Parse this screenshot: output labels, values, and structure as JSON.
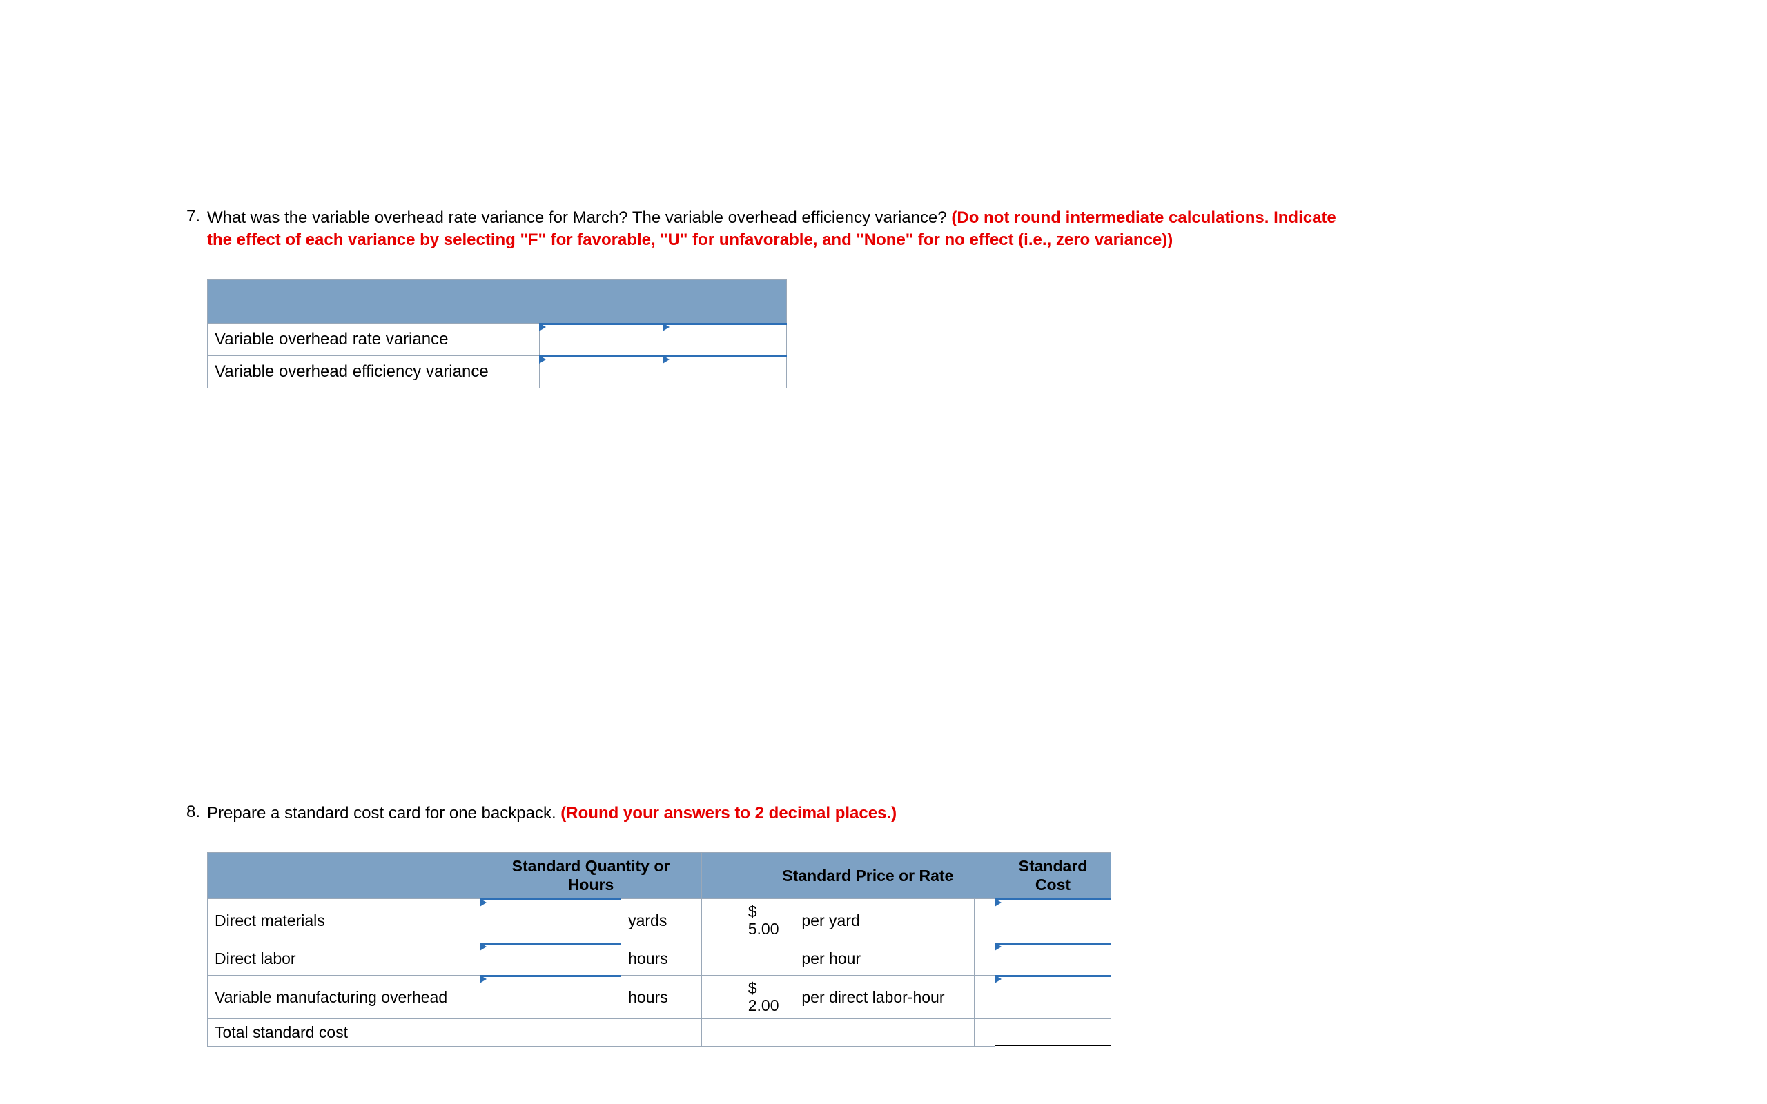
{
  "q7": {
    "number": "7.",
    "text": "What was the variable overhead rate variance for March? The variable overhead efficiency variance?",
    "note": "(Do not round intermediate calculations. Indicate the effect of each variance by selecting \"F\" for favorable, \"U\" for unfavorable, and \"None\" for no effect (i.e., zero variance))",
    "rows": [
      "Variable overhead rate variance",
      "Variable overhead efficiency variance"
    ]
  },
  "q8": {
    "number": "8.",
    "text": "Prepare a standard cost card for one backpack.",
    "note": "(Round your answers to 2 decimal places.)",
    "headers": {
      "qty": "Standard Quantity or Hours",
      "rate": "Standard Price or Rate",
      "cost": "Standard Cost"
    },
    "rows": [
      {
        "label": "Direct materials",
        "unit": "yards",
        "rate_sym": "$",
        "rate_amt": "5.00",
        "rate_unit": "per yard"
      },
      {
        "label": "Direct labor",
        "unit": "hours",
        "rate_sym": "",
        "rate_amt": "",
        "rate_unit": "per hour"
      },
      {
        "label": "Variable manufacturing overhead",
        "unit": "hours",
        "rate_sym": "$",
        "rate_amt": "2.00",
        "rate_unit": "per direct labor-hour"
      }
    ],
    "total_label": "Total standard cost"
  }
}
